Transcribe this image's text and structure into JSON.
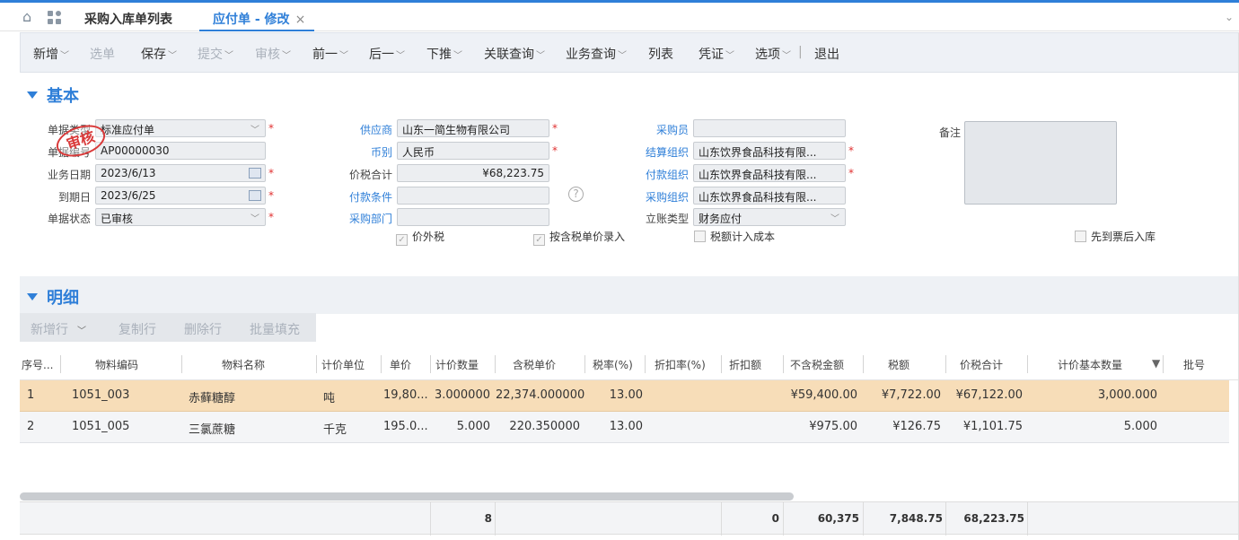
{
  "tabs": {
    "list_tab": "采购入库单列表",
    "active_tab": "应付单 - 修改",
    "close_glyph": "×"
  },
  "toolbar": {
    "new": "新增",
    "select": "选单",
    "save": "保存",
    "submit": "提交",
    "audit": "审核",
    "prev": "前一",
    "next": "后一",
    "push": "下推",
    "link_query": "关联查询",
    "biz_query": "业务查询",
    "list": "列表",
    "voucher": "凭证",
    "options": "选项",
    "separator": "|",
    "exit": "退出"
  },
  "basic": {
    "title": "基本",
    "labels": {
      "bill_type": "单据类型",
      "bill_no": "单据编号",
      "biz_date": "业务日期",
      "due_date": "到期日",
      "bill_status": "单据状态",
      "supplier": "供应商",
      "currency": "币别",
      "total_tax": "价税合计",
      "pay_term": "付款条件",
      "purchase_dept": "采购部门",
      "buyer": "采购员",
      "settle_org": "结算组织",
      "pay_org": "付款组织",
      "purchase_org": "采购组织",
      "account_type": "立账类型",
      "memo": "备注"
    },
    "values": {
      "bill_type": "标准应付单",
      "bill_no": "AP00000030",
      "biz_date": "2023/6/13",
      "due_date": "2023/6/25",
      "bill_status": "已审核",
      "supplier": "山东一简生物有限公司",
      "currency": "人民币",
      "total_tax": "¥68,223.75",
      "pay_term": "",
      "purchase_dept": "",
      "buyer": "",
      "settle_org": "山东饮界食品科技有限...",
      "pay_org": "山东饮界食品科技有限...",
      "purchase_org": "山东饮界食品科技有限...",
      "account_type": "财务应付",
      "memo": ""
    },
    "checks": {
      "tax_excluded": "价外税",
      "tax_price_entry": "按含税单价录入",
      "tax_in_cost": "税额计入成本",
      "invoice_first": "先到票后入库"
    },
    "stamp_text": "审核",
    "help_glyph": "?",
    "required_mark": "*"
  },
  "detail": {
    "title": "明细",
    "buttons": {
      "add_row": "新增行",
      "copy_row": "复制行",
      "delete_row": "删除行",
      "batch_fill": "批量填充"
    },
    "columns": [
      "序号...",
      "物料编码",
      "物料名称",
      "计价单位",
      "单价",
      "计价数量",
      "含税单价",
      "税率(%)",
      "折扣率(%)",
      "折扣额",
      "不含税金额",
      "税额",
      "价税合计",
      "计价基本数量",
      "批号"
    ],
    "rows": [
      {
        "seq": "1",
        "code": "1051_003",
        "name": "赤藓糖醇",
        "unit": "吨",
        "price": "19,80...",
        "qty": "3.000000",
        "tax_price": "22,374.000000",
        "tax_rate": "13.00",
        "disc_rate": "",
        "disc_amt": "",
        "amount": "¥59,400.00",
        "tax": "¥7,722.00",
        "total": "¥67,122.00",
        "base_qty": "3,000.000",
        "lot": ""
      },
      {
        "seq": "2",
        "code": "1051_005",
        "name": "三氯蔗糖",
        "unit": "千克",
        "price": "195.0...",
        "qty": "5.000",
        "tax_price": "220.350000",
        "tax_rate": "13.00",
        "disc_rate": "",
        "disc_amt": "",
        "amount": "¥975.00",
        "tax": "¥126.75",
        "total": "¥1,101.75",
        "base_qty": "5.000",
        "lot": ""
      }
    ],
    "footer": {
      "qty": "8",
      "disc_amt": "0",
      "amount": "60,375",
      "tax": "7,848.75",
      "total": "68,223.75"
    }
  },
  "colors": {
    "accent": "#2f7fd8",
    "selected_row": "#f7ddb8",
    "stamp": "#d93a3a"
  }
}
